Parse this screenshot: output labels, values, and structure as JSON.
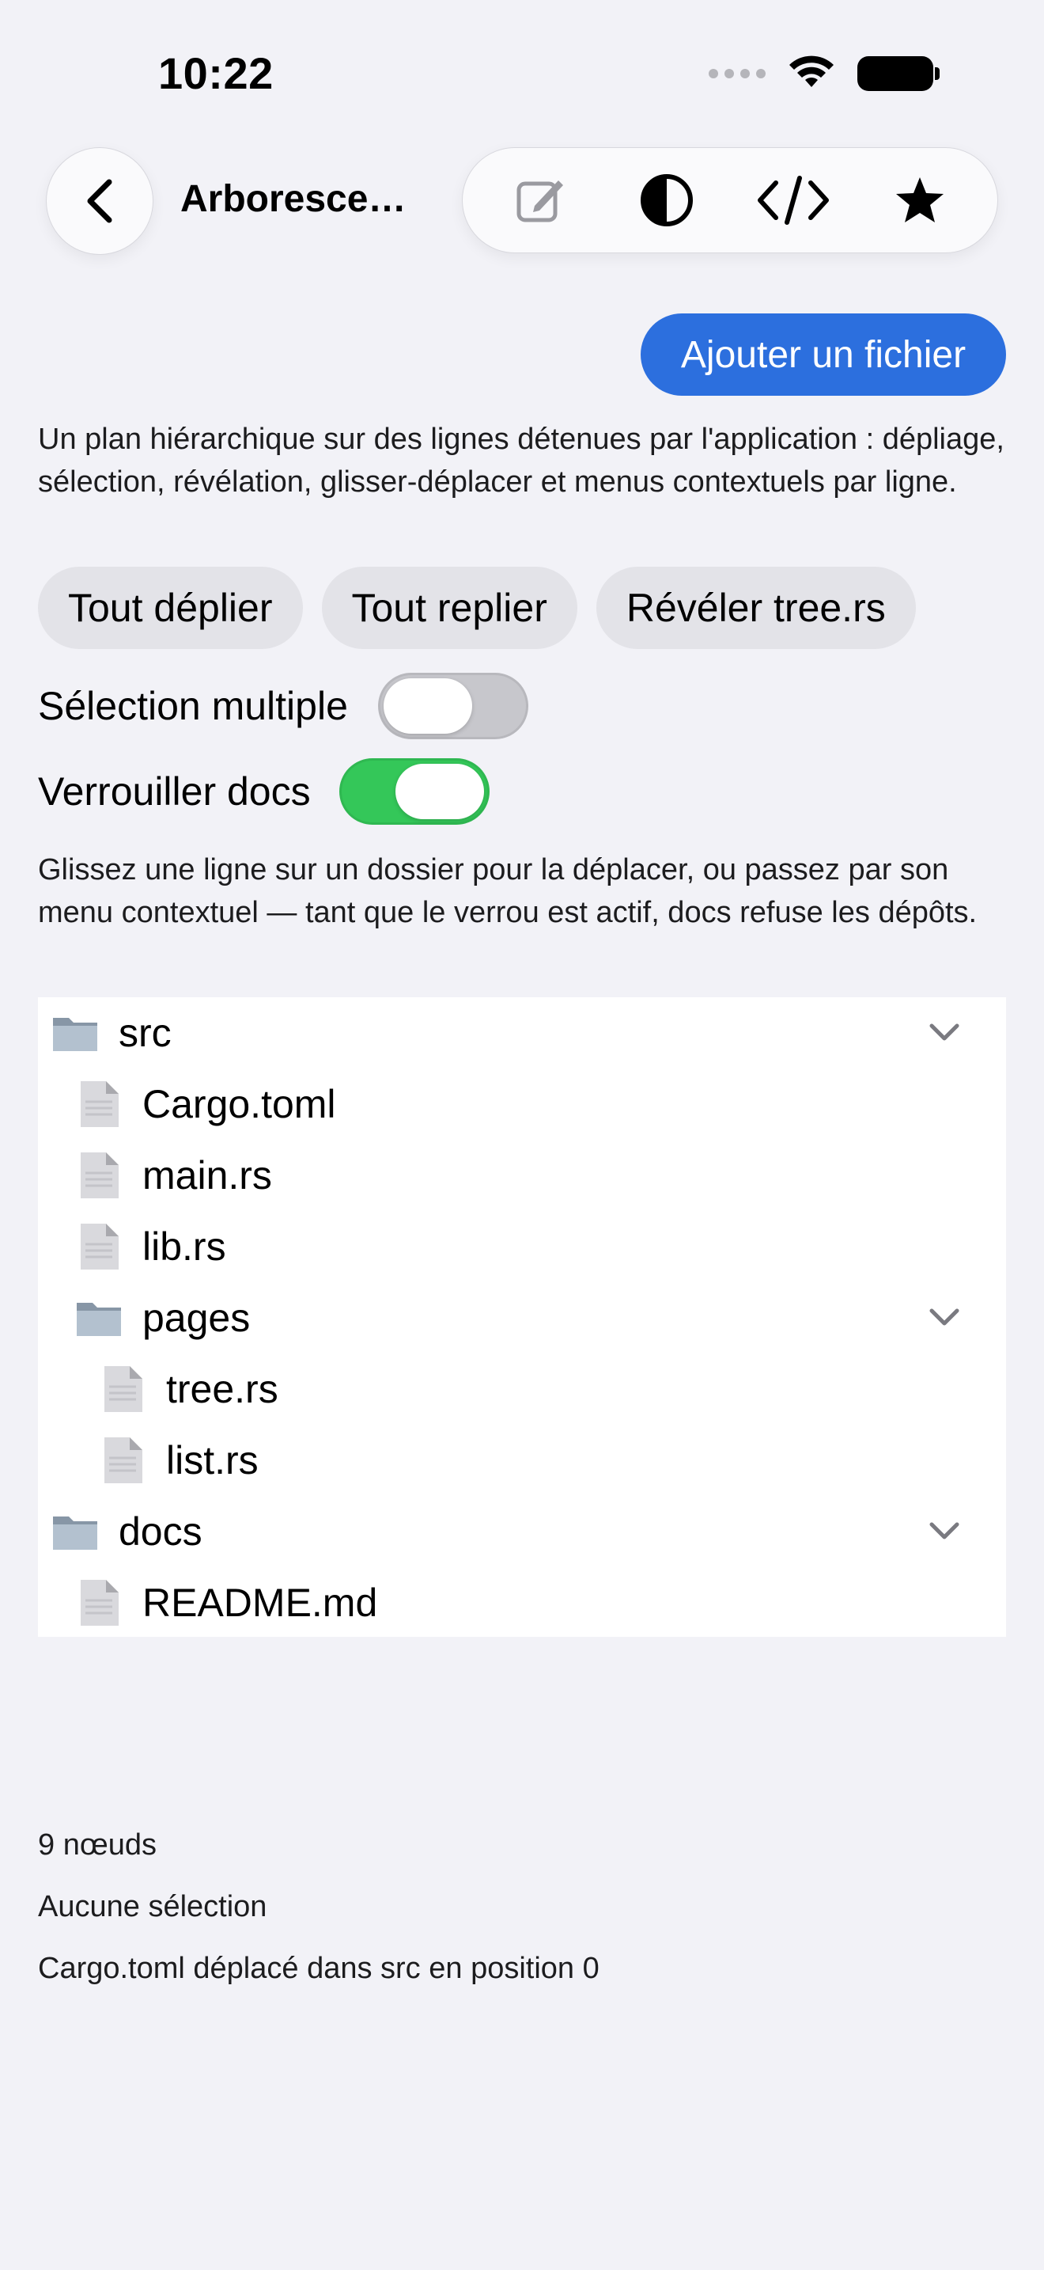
{
  "status_bar": {
    "time": "10:22"
  },
  "nav": {
    "title": "Arborescence",
    "toolbar_icons": [
      "compose-icon",
      "contrast-icon",
      "code-icon",
      "star-icon"
    ]
  },
  "actions": {
    "add_file_label": "Ajouter un fichier"
  },
  "description": "Un plan hiérarchique sur des lignes détenues par l'application : dépliage, sélection, révélation, glisser-déplacer et menus contextuels par ligne.",
  "pills": [
    "Tout déplier",
    "Tout replier",
    "Révéler tree.rs"
  ],
  "toggles": [
    {
      "label": "Sélection multiple",
      "on": false
    },
    {
      "label": "Verrouiller docs",
      "on": true
    }
  ],
  "hint": "Glissez une ligne sur un dossier pour la déplacer, ou passez par son menu contextuel — tant que le verrou est actif, docs refuse les dépôts.",
  "tree": [
    {
      "label": "src",
      "kind": "folder",
      "depth": 0,
      "expanded": true
    },
    {
      "label": "Cargo.toml",
      "kind": "file",
      "depth": 1
    },
    {
      "label": "main.rs",
      "kind": "file",
      "depth": 1
    },
    {
      "label": "lib.rs",
      "kind": "file",
      "depth": 1
    },
    {
      "label": "pages",
      "kind": "folder",
      "depth": 1,
      "expanded": true
    },
    {
      "label": "tree.rs",
      "kind": "file",
      "depth": 2
    },
    {
      "label": "list.rs",
      "kind": "file",
      "depth": 2
    },
    {
      "label": "docs",
      "kind": "folder",
      "depth": 0,
      "expanded": true
    },
    {
      "label": "README.md",
      "kind": "file",
      "depth": 1
    }
  ],
  "footer": {
    "node_count": "9 nœuds",
    "selection": "Aucune sélection",
    "last_action": "Cargo.toml déplacé dans src en position 0"
  },
  "colors": {
    "accent": "#2c6fde",
    "toggle_on": "#34c759",
    "background": "#f2f2f7"
  }
}
